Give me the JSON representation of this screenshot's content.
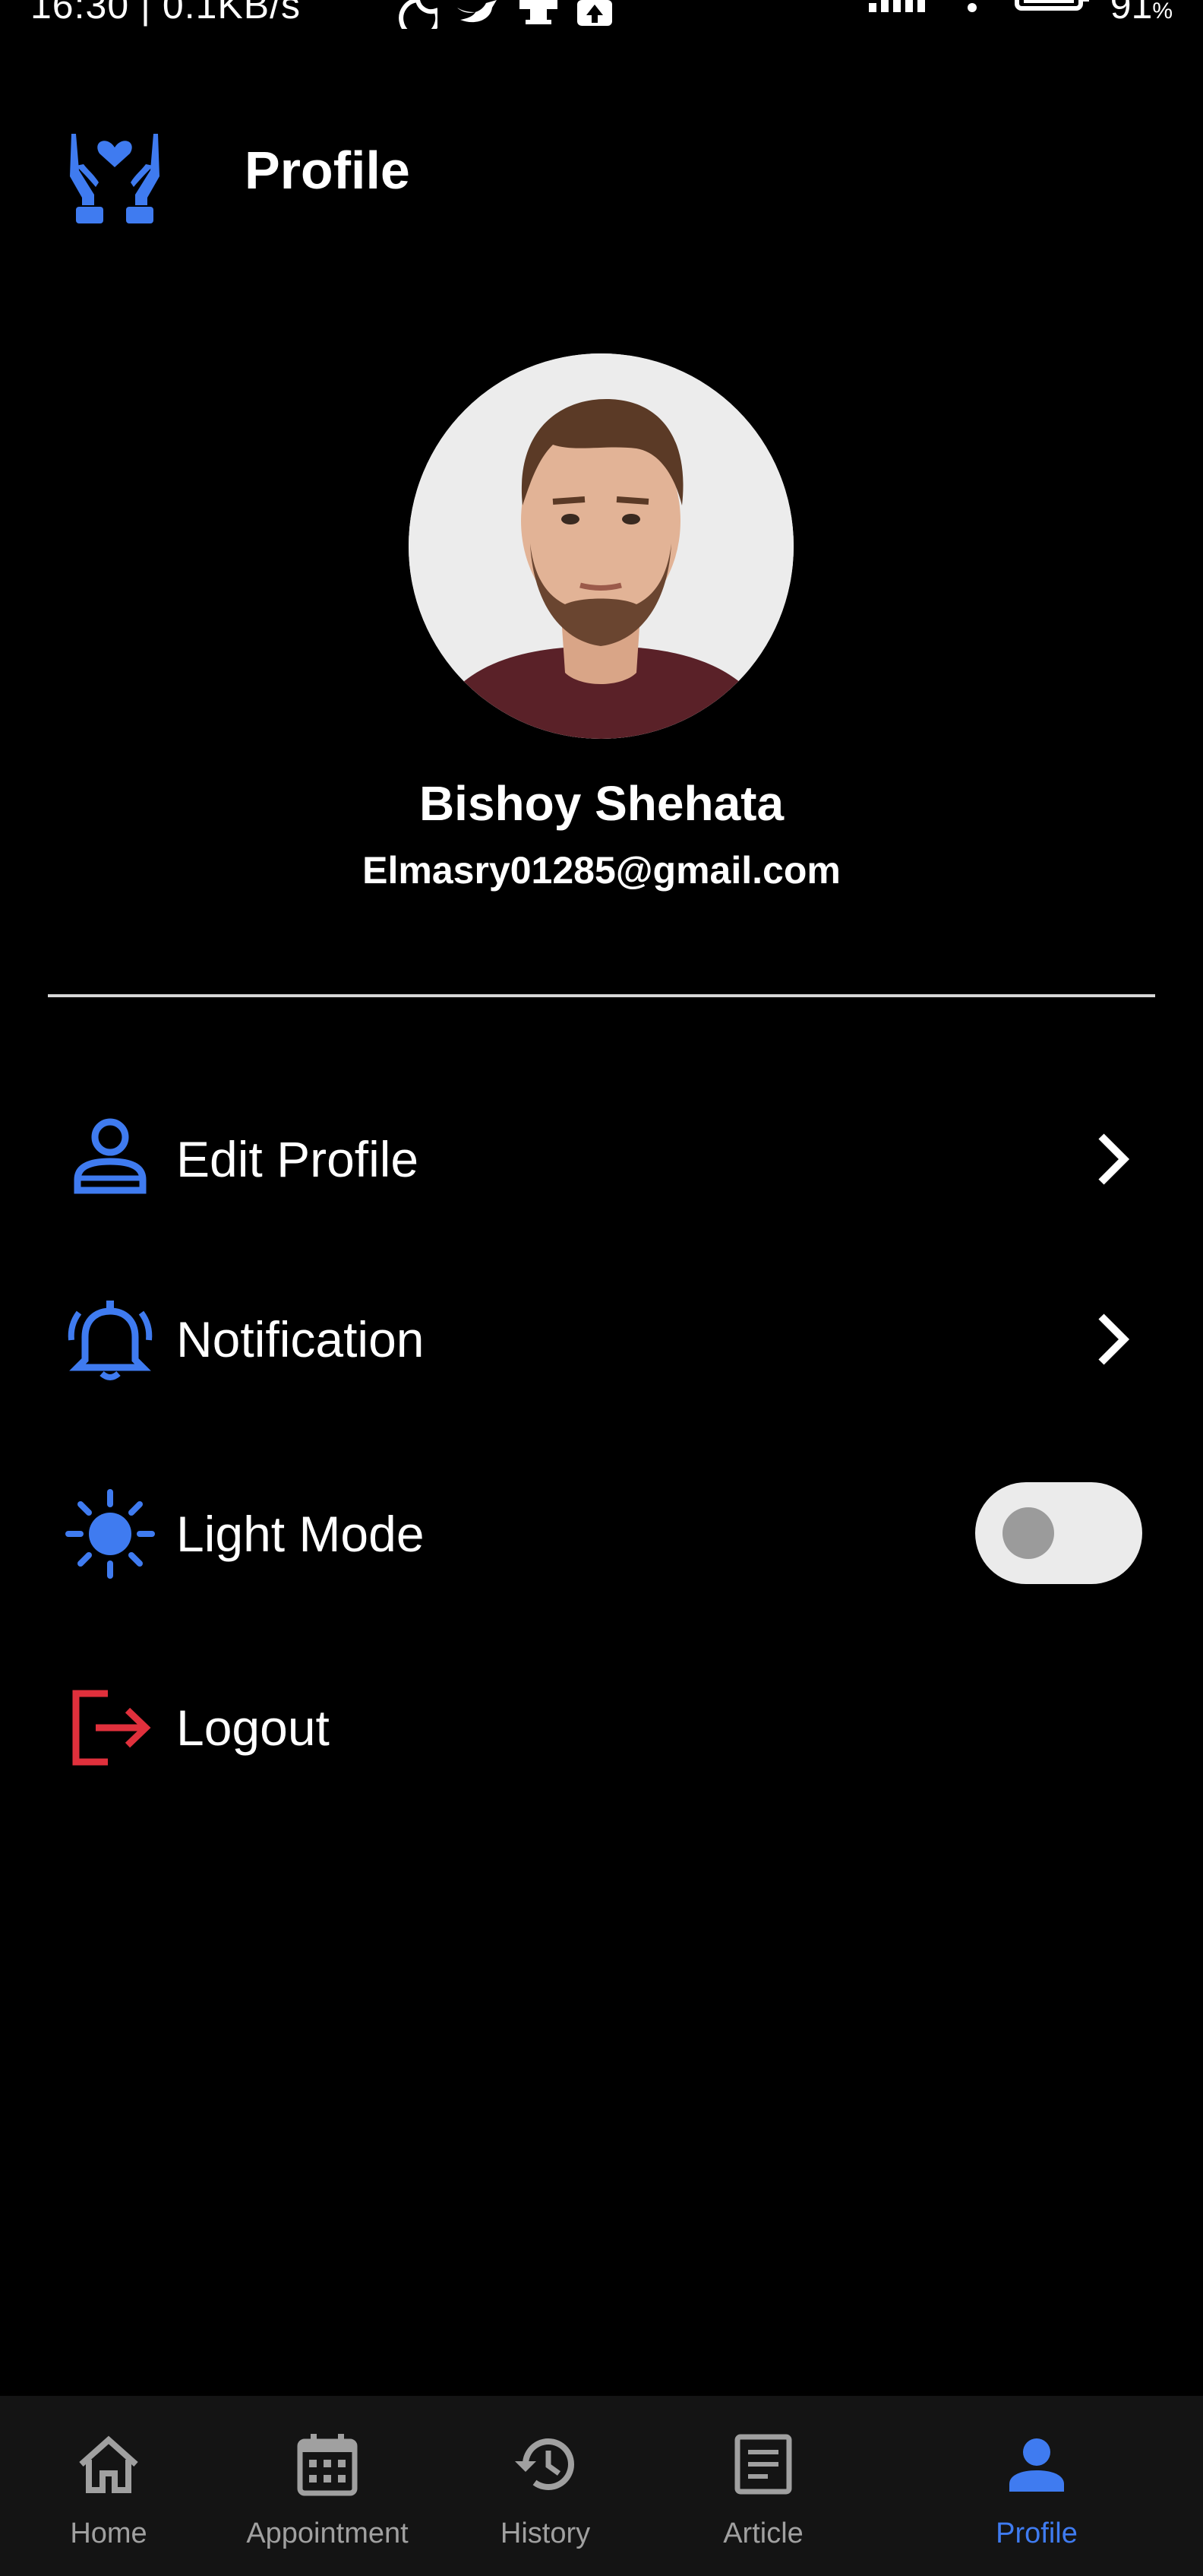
{
  "status_bar": {
    "time_speed": "16:30 | 0.1KB/s",
    "battery": "91",
    "battery_unit": "%"
  },
  "header": {
    "title": "Profile"
  },
  "user": {
    "name": "Bishoy Shehata",
    "email": "Elmasry01285@gmail.com"
  },
  "menu": [
    {
      "label": "Edit Profile",
      "icon": "person-icon"
    },
    {
      "label": "Notification",
      "icon": "bell-icon"
    },
    {
      "label": "Light Mode",
      "icon": "sun-icon",
      "toggle_on": false
    },
    {
      "label": "Logout",
      "icon": "logout-icon"
    }
  ],
  "nav": [
    {
      "label": "Home",
      "icon": "home-icon"
    },
    {
      "label": "Appointment",
      "icon": "calendar-icon"
    },
    {
      "label": "History",
      "icon": "history-icon"
    },
    {
      "label": "Article",
      "icon": "article-icon"
    },
    {
      "label": "Profile",
      "icon": "profile-icon",
      "active": true
    }
  ],
  "colors": {
    "accent": "#3f7bf0",
    "logout": "#e0303c",
    "background": "#000000",
    "nav_background": "#141414"
  }
}
